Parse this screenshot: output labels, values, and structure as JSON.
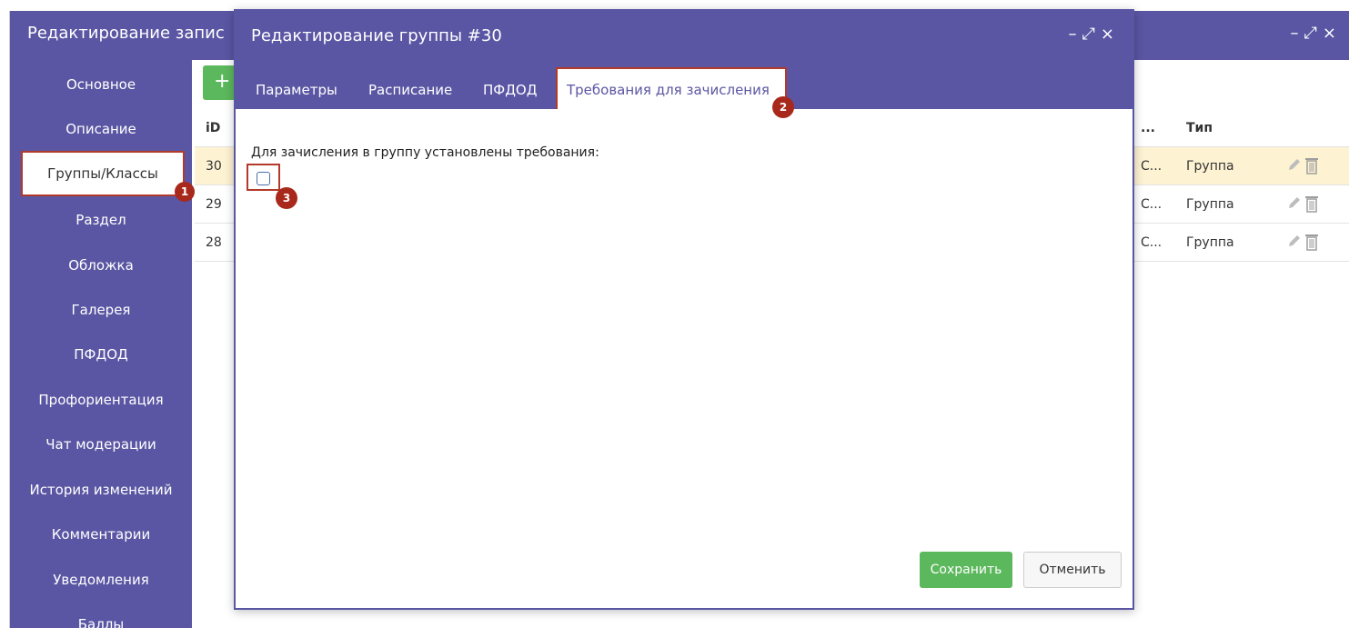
{
  "background_window": {
    "title": "Редактирование запис",
    "controls": {
      "minimize": "–",
      "maximize": "⤢",
      "close": "×"
    }
  },
  "sidebar": {
    "items": [
      {
        "label": "Основное"
      },
      {
        "label": "Описание"
      },
      {
        "label": "Группы/Классы",
        "active": true
      },
      {
        "label": "Раздел"
      },
      {
        "label": "Обложка"
      },
      {
        "label": "Галерея"
      },
      {
        "label": "ПФДОД"
      },
      {
        "label": "Профориентация"
      },
      {
        "label": "Чат модерации"
      },
      {
        "label": "История изменений"
      },
      {
        "label": "Комментарии"
      },
      {
        "label": "Уведомления"
      },
      {
        "label": "Баллы"
      }
    ],
    "badge": "1"
  },
  "bg_table": {
    "add_label": "+",
    "headers": {
      "id": "iD",
      "col": "...",
      "type": "Тип"
    },
    "rows": [
      {
        "id": "30",
        "col": "С...",
        "type": "Группа"
      },
      {
        "id": "29",
        "col": "С...",
        "type": "Группа"
      },
      {
        "id": "28",
        "col": "С...",
        "type": "Группа"
      }
    ]
  },
  "modal": {
    "title": "Редактирование группы #30",
    "controls": {
      "minimize": "–",
      "maximize": "⤢",
      "close": "×"
    },
    "tabs": [
      {
        "label": "Параметры"
      },
      {
        "label": "Расписание"
      },
      {
        "label": "ПФДОД"
      },
      {
        "label": "Требования для зачисления",
        "active": true
      }
    ],
    "tab_badge": "2",
    "requirements_label": "Для зачисления в группу установлены требования:",
    "checkbox_checked": false,
    "checkbox_badge": "3",
    "save_label": "Сохранить",
    "cancel_label": "Отменить"
  },
  "colors": {
    "header": "#5a56a3",
    "annotation": "#a8291b",
    "save": "#5cb85c",
    "selected_row": "#fdf2d2"
  }
}
